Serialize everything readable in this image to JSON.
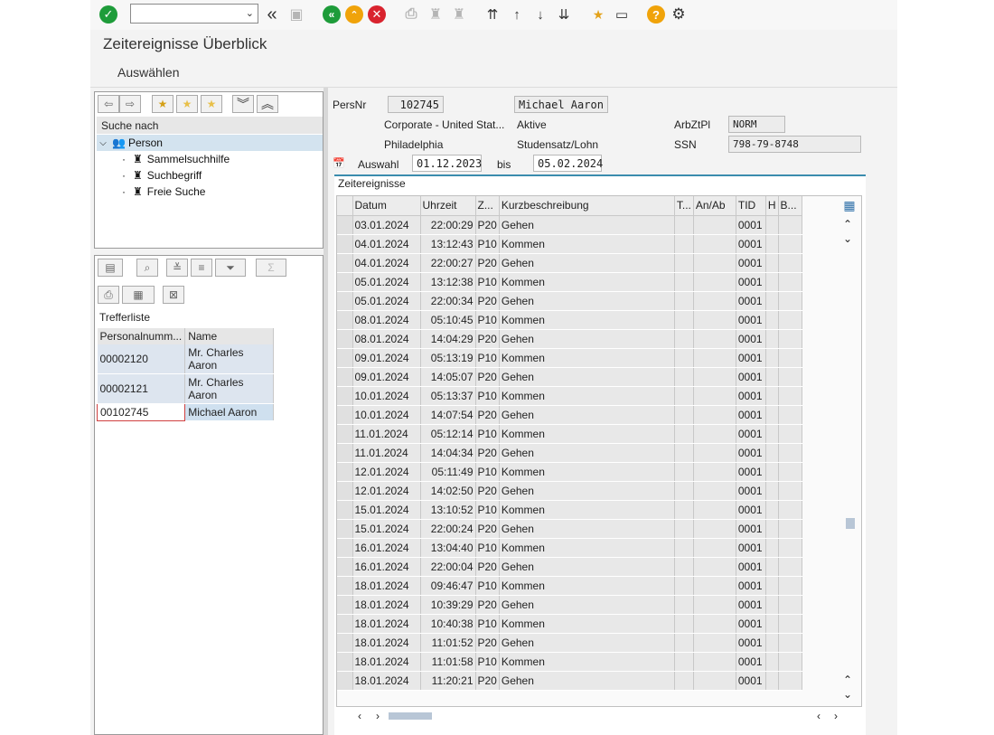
{
  "toolbar": {
    "enter_icon": "check-icon",
    "command_field": "",
    "icons": [
      "back-double-icon",
      "save-icon",
      "back-icon",
      "exit-icon",
      "cancel-icon",
      "print-icon",
      "find-icon",
      "find-next-icon",
      "first-page-icon",
      "prev-page-icon",
      "next-page-icon",
      "last-page-icon",
      "create-session-icon",
      "shortcut-icon",
      "help-icon",
      "settings-icon"
    ],
    "colors": {
      "green": "#1e9c3a",
      "orange": "#f0a30a",
      "red": "#d9232e",
      "help": "#f0a30a"
    }
  },
  "title": "Zeitereignisse Überblick",
  "menu": {
    "select_label": "Auswählen"
  },
  "nav": {
    "search_header": "Suche nach",
    "tree": {
      "root": "Person",
      "children": [
        "Sammelsuchhilfe",
        "Suchbegriff",
        "Freie Suche"
      ]
    }
  },
  "hitlist": {
    "label": "Trefferliste",
    "columns": [
      "Personalnumm...",
      "Name"
    ],
    "rows": [
      {
        "pernr": "00002120",
        "name": "Mr. Charles Aaron"
      },
      {
        "pernr": "00002121",
        "name": "Mr. Charles Aaron"
      },
      {
        "pernr": "00102745",
        "name": "Michael Aaron"
      }
    ]
  },
  "header": {
    "persnr_label": "PersNr",
    "persnr": "102745",
    "name": "Michael Aaron",
    "org": "Corporate - United Stat...",
    "status": "Aktive",
    "city": "Philadelphia",
    "pay_type": "Studensatz/Lohn",
    "arbztpl_label": "ArbZtPl",
    "arbztpl": "NORM",
    "ssn_label": "SSN",
    "ssn": "798-79-8748",
    "auswahl_label": "Auswahl",
    "from": "01.12.2023",
    "bis_label": "bis",
    "to": "05.02.2024"
  },
  "events": {
    "title": "Zeitereignisse",
    "columns": [
      "Datum",
      "Uhrzeit",
      "Z...",
      "Kurzbeschreibung",
      "T...",
      "An/Ab",
      "TID",
      "H",
      "B..."
    ],
    "rows": [
      {
        "date": "03.01.2024",
        "time": "22:00:29",
        "type": "P20",
        "desc": "Gehen",
        "tid": "0001"
      },
      {
        "date": "04.01.2024",
        "time": "13:12:43",
        "type": "P10",
        "desc": "Kommen",
        "tid": "0001"
      },
      {
        "date": "04.01.2024",
        "time": "22:00:27",
        "type": "P20",
        "desc": "Gehen",
        "tid": "0001"
      },
      {
        "date": "05.01.2024",
        "time": "13:12:38",
        "type": "P10",
        "desc": "Kommen",
        "tid": "0001"
      },
      {
        "date": "05.01.2024",
        "time": "22:00:34",
        "type": "P20",
        "desc": "Gehen",
        "tid": "0001"
      },
      {
        "date": "08.01.2024",
        "time": "05:10:45",
        "type": "P10",
        "desc": "Kommen",
        "tid": "0001"
      },
      {
        "date": "08.01.2024",
        "time": "14:04:29",
        "type": "P20",
        "desc": "Gehen",
        "tid": "0001"
      },
      {
        "date": "09.01.2024",
        "time": "05:13:19",
        "type": "P10",
        "desc": "Kommen",
        "tid": "0001"
      },
      {
        "date": "09.01.2024",
        "time": "14:05:07",
        "type": "P20",
        "desc": "Gehen",
        "tid": "0001"
      },
      {
        "date": "10.01.2024",
        "time": "05:13:37",
        "type": "P10",
        "desc": "Kommen",
        "tid": "0001"
      },
      {
        "date": "10.01.2024",
        "time": "14:07:54",
        "type": "P20",
        "desc": "Gehen",
        "tid": "0001"
      },
      {
        "date": "11.01.2024",
        "time": "05:12:14",
        "type": "P10",
        "desc": "Kommen",
        "tid": "0001"
      },
      {
        "date": "11.01.2024",
        "time": "14:04:34",
        "type": "P20",
        "desc": "Gehen",
        "tid": "0001"
      },
      {
        "date": "12.01.2024",
        "time": "05:11:49",
        "type": "P10",
        "desc": "Kommen",
        "tid": "0001"
      },
      {
        "date": "12.01.2024",
        "time": "14:02:50",
        "type": "P20",
        "desc": "Gehen",
        "tid": "0001"
      },
      {
        "date": "15.01.2024",
        "time": "13:10:52",
        "type": "P10",
        "desc": "Kommen",
        "tid": "0001"
      },
      {
        "date": "15.01.2024",
        "time": "22:00:24",
        "type": "P20",
        "desc": "Gehen",
        "tid": "0001"
      },
      {
        "date": "16.01.2024",
        "time": "13:04:40",
        "type": "P10",
        "desc": "Kommen",
        "tid": "0001"
      },
      {
        "date": "16.01.2024",
        "time": "22:00:04",
        "type": "P20",
        "desc": "Gehen",
        "tid": "0001"
      },
      {
        "date": "18.01.2024",
        "time": "09:46:47",
        "type": "P10",
        "desc": "Kommen",
        "tid": "0001"
      },
      {
        "date": "18.01.2024",
        "time": "10:39:29",
        "type": "P20",
        "desc": "Gehen",
        "tid": "0001"
      },
      {
        "date": "18.01.2024",
        "time": "10:40:38",
        "type": "P10",
        "desc": "Kommen",
        "tid": "0001"
      },
      {
        "date": "18.01.2024",
        "time": "11:01:52",
        "type": "P20",
        "desc": "Gehen",
        "tid": "0001"
      },
      {
        "date": "18.01.2024",
        "time": "11:01:58",
        "type": "P10",
        "desc": "Kommen",
        "tid": "0001"
      },
      {
        "date": "18.01.2024",
        "time": "11:20:21",
        "type": "P20",
        "desc": "Gehen",
        "tid": "0001"
      }
    ]
  }
}
